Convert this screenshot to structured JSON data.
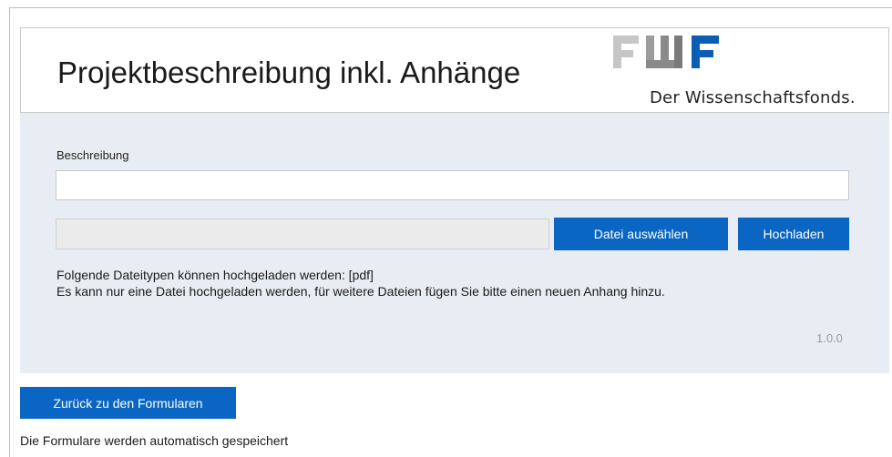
{
  "header": {
    "title": "Projektbeschreibung inkl. Anhänge",
    "logo": {
      "text": "FWF",
      "tagline": "Der Wissenschaftsfonds.",
      "colors": {
        "light": "#c6c6c6",
        "mid": "#9c9c9c",
        "dark": "#6f6f6f",
        "blue": "#0a5fb4"
      }
    }
  },
  "form": {
    "description_label": "Beschreibung",
    "description_value": "",
    "file_display_value": "",
    "choose_file_label": "Datei auswählen",
    "upload_label": "Hochladen",
    "info_allowed_types": "Folgende Dateitypen können hochgeladen werden: [pdf]",
    "info_single_file": "Es kann nur eine Datei hochgeladen werden, für weitere Dateien fügen Sie bitte einen neuen Anhang hinzu.",
    "version": "1.0.0"
  },
  "footer": {
    "back_button_label": "Zurück zu den Formularen",
    "autosave_note": "Die Formulare werden automatisch gespeichert"
  },
  "colors": {
    "primary_button": "#0a66c2",
    "panel_background": "#e8edf3"
  }
}
